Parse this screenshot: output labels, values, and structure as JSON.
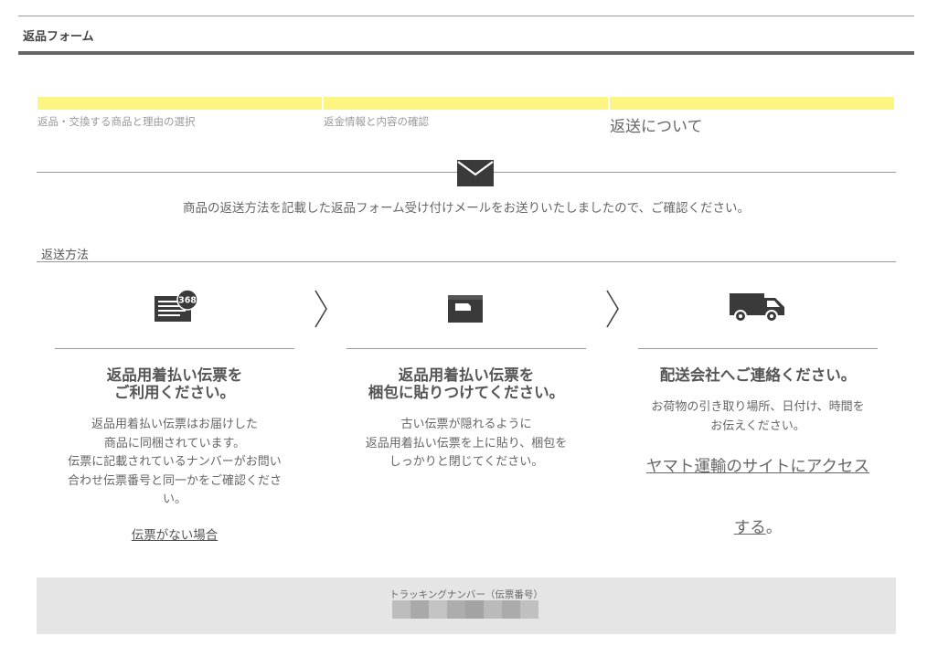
{
  "header": {
    "title": "返品フォーム"
  },
  "steps": [
    {
      "label": "返品・交換する商品と理由の選択"
    },
    {
      "label": "返金情報と内容の確認"
    },
    {
      "label": "返送について"
    }
  ],
  "mail": {
    "message": "商品の返送方法を記載した返品フォーム受け付けメールをお送りいたしましたので、ご確認ください。"
  },
  "method": {
    "title": "返送方法",
    "columns": [
      {
        "icon": "slip-368-icon",
        "title_line1": "返品用着払い伝票を",
        "title_line2": "ご利用ください。",
        "body_line1": "返品用着払い伝票はお届けした",
        "body_line2": "商品に同梱されています。",
        "body_line3": "伝票に記載されているナンバーがお問い",
        "body_line4": "合わせ伝票番号と同一かをご確認くださ",
        "body_line5": "い。",
        "link": "伝票がない場合"
      },
      {
        "icon": "package-box-icon",
        "title_line1": "返品用着払い伝票を",
        "title_line2": "梱包に貼りつけてください。",
        "body_line1": "古い伝票が隠れるように",
        "body_line2": "返品用着払い伝票を上に貼り、梱包を",
        "body_line3": "しっかりと閉じてください。"
      },
      {
        "icon": "delivery-truck-icon",
        "title_line1": "配送会社へご連絡ください。",
        "body_line1": "お荷物の引き取り場所、日付け、時間を",
        "body_line2": "お伝えください。",
        "link_line1": "ヤマト運輸のサイトにアクセス",
        "link_line2": "する",
        "link_suffix": "。"
      }
    ]
  },
  "tracking": {
    "label": "トラッキングナンバー（伝票番号）"
  },
  "colors": {
    "step_highlight": "#fdf582",
    "tracking_bg": "#e5e5e5"
  }
}
